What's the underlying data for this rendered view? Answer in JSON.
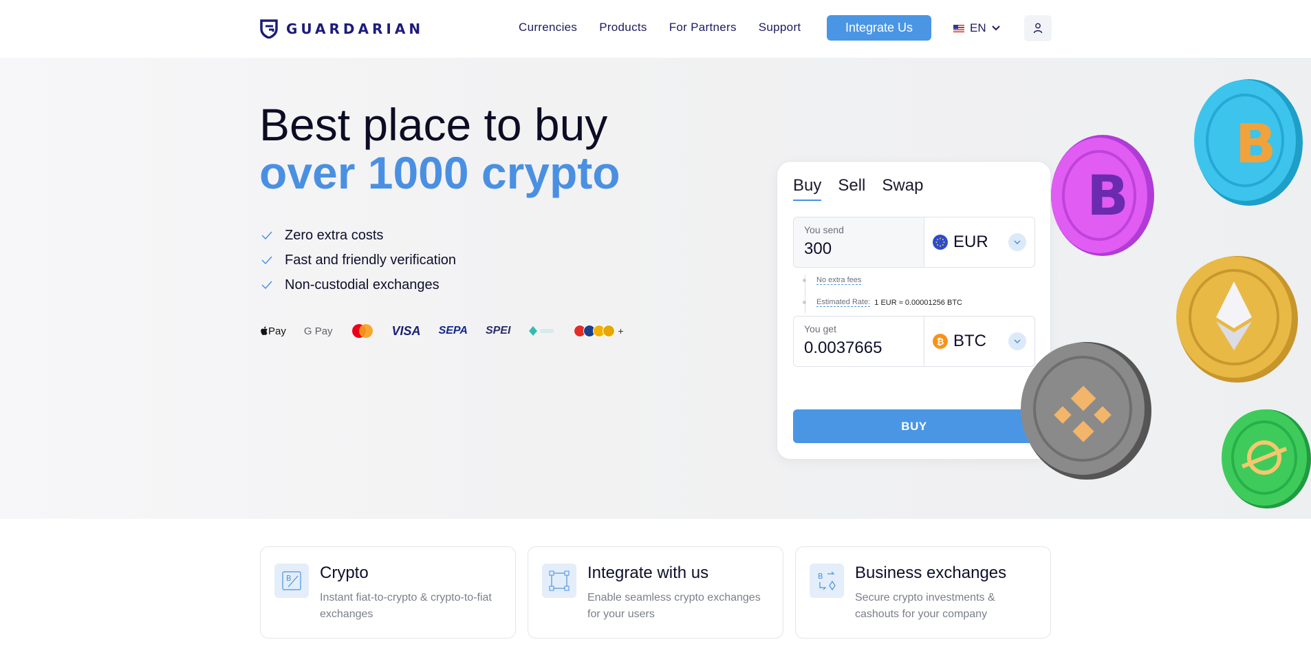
{
  "header": {
    "logo_text": "GUARDARIAN",
    "nav": [
      "Currencies",
      "Products",
      "For Partners",
      "Support"
    ],
    "cta": "Integrate Us",
    "lang": "EN"
  },
  "hero": {
    "title_line1": "Best place to buy",
    "title_line2": "over 1000 crypto",
    "features": [
      "Zero extra costs",
      "Fast and friendly verification",
      "Non-custodial exchanges"
    ],
    "payments": {
      "applepay": "Pay",
      "gpay": "G Pay",
      "visa": "VISA",
      "sepa": "SEPA",
      "spei": "SPEI",
      "plus": "+"
    }
  },
  "widget": {
    "tabs": [
      "Buy",
      "Sell",
      "Swap"
    ],
    "send": {
      "label": "You send",
      "value": "300",
      "currency": "EUR"
    },
    "info": {
      "no_fees": "No extra fees",
      "rate_label": "Estimated Rate:",
      "rate_value": "1 EUR ≈ 0.00001256 BTC"
    },
    "get": {
      "label": "You get",
      "value": "0.0037665",
      "currency": "BTC"
    },
    "button": "BUY"
  },
  "cards": [
    {
      "title": "Crypto",
      "desc": "Instant fiat-to-crypto & crypto-to-fiat exchanges"
    },
    {
      "title": "Integrate with us",
      "desc": "Enable seamless crypto exchanges for your users"
    },
    {
      "title": "Business exchanges",
      "desc": "Secure crypto investments & cashouts for your company"
    }
  ],
  "colors": {
    "accent": "#4a90e2",
    "brand": "#1c1b7c",
    "btc": "#f7931a",
    "eur": "#2c4bd1"
  }
}
